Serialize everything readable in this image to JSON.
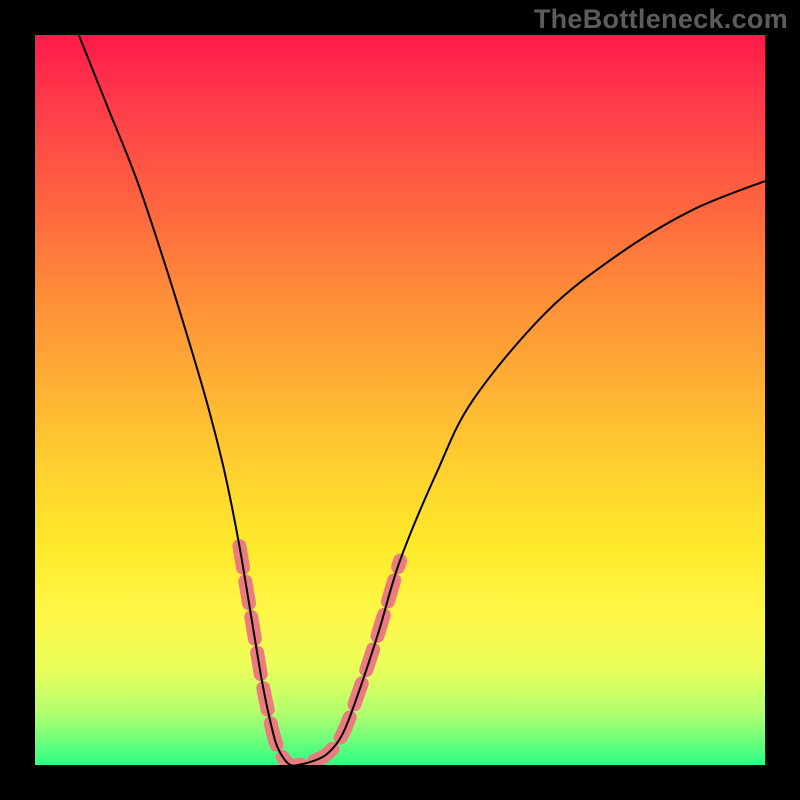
{
  "watermark": "TheBottleneck.com",
  "chart_data": {
    "type": "line",
    "title": "",
    "xlabel": "",
    "ylabel": "",
    "xlim": [
      0,
      100
    ],
    "ylim": [
      0,
      100
    ],
    "series": [
      {
        "name": "curve",
        "x": [
          6,
          10,
          14,
          18,
          22,
          24,
          26,
          28,
          30,
          31,
          32,
          33,
          34,
          35,
          36,
          38,
          40,
          42,
          44,
          47,
          50,
          55,
          60,
          70,
          80,
          90,
          100
        ],
        "y": [
          100,
          90,
          80,
          68,
          55,
          48,
          40,
          30,
          18,
          12,
          7,
          3,
          1,
          0,
          0,
          0.5,
          1.5,
          4,
          9,
          18,
          28,
          40,
          50,
          62,
          70,
          76,
          80
        ]
      }
    ],
    "highlight_band": {
      "y_threshold": 30,
      "color": "#ec7b80",
      "stroke_width": 14
    },
    "gradient_stops": [
      {
        "pos": 0.0,
        "color": "#ff1a4a"
      },
      {
        "pos": 0.35,
        "color": "#ff8b39"
      },
      {
        "pos": 0.7,
        "color": "#ffe92b"
      },
      {
        "pos": 1.0,
        "color": "#2eff86"
      }
    ]
  }
}
